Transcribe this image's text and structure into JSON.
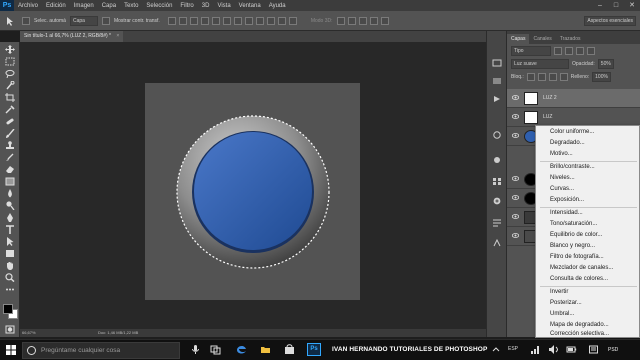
{
  "app": {
    "logo": "Ps",
    "brand_color": "#31a8ff"
  },
  "menubar": {
    "items": [
      "Archivo",
      "Edición",
      "Imagen",
      "Capa",
      "Texto",
      "Selección",
      "Filtro",
      "3D",
      "Vista",
      "Ventana",
      "Ayuda"
    ],
    "min_glyph": "–",
    "max_glyph": "□",
    "close_glyph": "✕"
  },
  "options": {
    "select_label": "Selec. automá",
    "select_target": "Capa",
    "show_transform": "Mostrar contr. transf.",
    "mode_label": "Modo 3D:",
    "workspace": "Aspectos esenciales"
  },
  "document": {
    "tab_title": "Sin título-1 al 66,7% (LUZ 2, RGB/8#) *",
    "close_glyph": "×",
    "zoom": "66,67%",
    "info": "Doc: 1,46 MB/1,22 MB"
  },
  "layers_panel": {
    "tabs": [
      "Capas",
      "Canales",
      "Trazados"
    ],
    "filter_label": "Tipo",
    "blend_mode": "Luz suave",
    "opacity_label": "Opacidad:",
    "opacity_value": "50%",
    "lock_label": "Bloq.:",
    "fill_label": "Relleno:",
    "fill_value": "100%",
    "layers": [
      {
        "name": "LUZ 2",
        "selected": true
      },
      {
        "name": "LUZ",
        "selected": false
      }
    ]
  },
  "context_menu": {
    "groups": [
      [
        "Color uniforme...",
        "Degradado...",
        "Motivo..."
      ],
      [
        "Brillo/contraste...",
        "Niveles...",
        "Curvas...",
        "Exposición..."
      ],
      [
        "Intensidad...",
        "Tono/saturación...",
        "Equilibrio de color...",
        "Blanco y negro...",
        "Filtro de fotografía...",
        "Mezclador de canales...",
        "Consulta de colores..."
      ],
      [
        "Invertir",
        "Posterizar...",
        "Umbral...",
        "Mapa de degradado...",
        "Corrección selectiva..."
      ]
    ]
  },
  "taskbar": {
    "search_placeholder": "Pregúntame cualquier cosa",
    "watermark": "IVAN HERNANDO TUTORIALES DE PHOTOSHOP",
    "ps_badge": "Ps",
    "tray_lang": "ESP",
    "clock": "PSD"
  },
  "colors": {
    "button_blue": "#2f5fae",
    "button_ring": "#7f7f7f",
    "canvas_bg": "#535353",
    "workspace_bg": "#282828"
  }
}
